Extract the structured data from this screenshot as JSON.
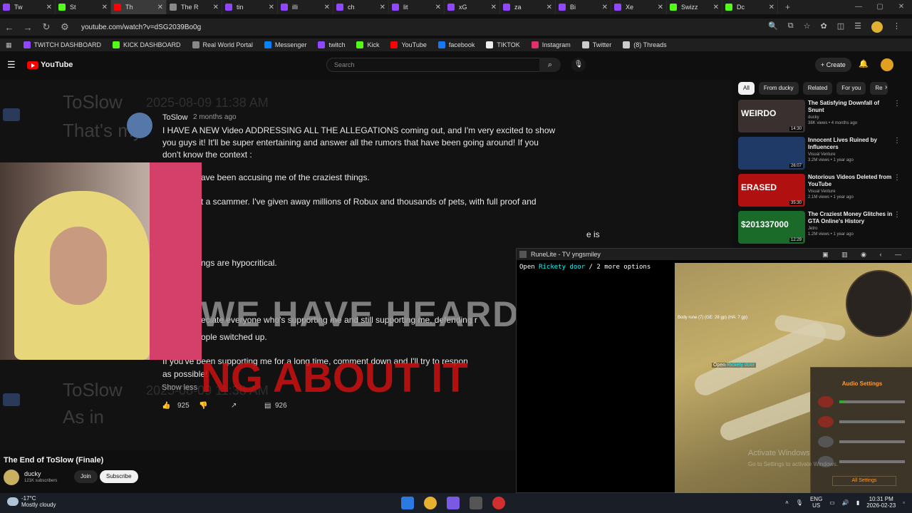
{
  "tabs": [
    {
      "label": "Tw",
      "color": "#9146ff"
    },
    {
      "label": "St",
      "color": "#53fc18"
    },
    {
      "label": "Th",
      "color": "#ff0000",
      "active": true
    },
    {
      "label": "The R",
      "color": "#888888"
    },
    {
      "label": "tin",
      "color": "#9146ff"
    },
    {
      "label": "illi",
      "color": "#9146ff"
    },
    {
      "label": "ch",
      "color": "#9146ff"
    },
    {
      "label": "lit",
      "color": "#9146ff"
    },
    {
      "label": "xG",
      "color": "#9146ff"
    },
    {
      "label": "za",
      "color": "#9146ff"
    },
    {
      "label": "Bi",
      "color": "#9146ff"
    },
    {
      "label": "Xe",
      "color": "#9146ff"
    },
    {
      "label": "Swizz",
      "color": "#53fc18"
    },
    {
      "label": "Dc",
      "color": "#53fc18"
    }
  ],
  "address": {
    "url": "youtube.com/watch?v=dSG2039Bo0g"
  },
  "bookmarks": [
    {
      "label": "TWITCH DASHBOARD",
      "color": "#9146ff"
    },
    {
      "label": "KICK DASHBOARD",
      "color": "#53fc18"
    },
    {
      "label": "Real World Portal",
      "color": "#888888"
    },
    {
      "label": "Messenger",
      "color": "#0084ff"
    },
    {
      "label": "twitch",
      "color": "#9146ff"
    },
    {
      "label": "Kick",
      "color": "#53fc18"
    },
    {
      "label": "YouTube",
      "color": "#ff0000"
    },
    {
      "label": "facebook",
      "color": "#1877f2"
    },
    {
      "label": "TIKTOK",
      "color": "#eeeeee"
    },
    {
      "label": "Instagram",
      "color": "#e1306c"
    },
    {
      "label": "Twitter",
      "color": "#cccccc"
    },
    {
      "label": "(8) Threads",
      "color": "#cccccc"
    }
  ],
  "yt": {
    "logo": "YouTube",
    "search_placeholder": "Search",
    "create": "Create"
  },
  "video": {
    "ghost_author_1": "ToSlow",
    "ghost_date_1": "2025-08-09 11:38 AM",
    "ghost_text_1": "That's my",
    "ghost_author_2": "ToSlow",
    "ghost_date_2": "2025-08-09 11:38 AM",
    "ghost_text_2": "As in",
    "comment": {
      "author": "ToSlow",
      "date": "2 months ago",
      "lines": [
        "I HAVE A NEW Video ADDRESSING ALL THE ALLEGATIONS coming out, and I'm very excited to show",
        "you guys it! It'll be super entertaining and answer all the rumors that have been going around! If you",
        "don't know the context :",
        "ave been accusing me of the craziest things.",
        "t a scammer. I've given away millions of Robux and thousands of pets, with full proof and",
        "e is",
        "ngs are hypocritical.",
        "eciate everyone who's supporting me and still supporting me, defending r",
        "ople switched up.",
        "If you've been supporting me for a long time, comment down and I'll try to respon",
        "as possible!"
      ],
      "show_less": "Show less",
      "likes": "925",
      "replies": "926"
    },
    "banner_top": "WE HAVE HEARD",
    "banner_bottom": "NG ABOUT IT"
  },
  "below": {
    "title": "The End of ToSlow (Finale)",
    "channel": "ducky",
    "subs": "121K subscribers",
    "join": "Join",
    "subscribe": "Subscribe"
  },
  "sidebar": {
    "chips": [
      "All",
      "From ducky",
      "Related",
      "For you",
      "Re"
    ],
    "items": [
      {
        "title": "The Satisfying Downfall of Snunt",
        "channel": "ducky",
        "views": "38K views • 4 months ago",
        "duration": "14:30",
        "thumb_text": "WEIRDO",
        "thumb_color": "#3a3030"
      },
      {
        "title": "Innocent Lives Ruined by Influencers",
        "channel": "Visual Venture",
        "views": "3.2M views • 1 year ago",
        "duration": "26:07",
        "thumb_text": "",
        "thumb_color": "#1f3a66"
      },
      {
        "title": "Notorious Videos Deleted from YouTube",
        "channel": "Visual Venture",
        "views": "2.1M views • 1 year ago",
        "duration": "35:30",
        "thumb_text": "ERASED",
        "thumb_color": "#b01010"
      },
      {
        "title": "The Craziest Money Glitches in GTA Online's History",
        "channel": "Jetro",
        "views": "1.2M views • 1 year ago",
        "duration": "12:29",
        "thumb_text": "$201337000",
        "thumb_color": "#1a6a2a"
      }
    ]
  },
  "runelite": {
    "title": "RuneLite - TV yngsmiley",
    "top_prefix": "Open ",
    "top_target": "Rickety door",
    "top_suffix": " / 2 more options",
    "ground_label": "Body rune (7) (GE: 28 gp) (HA: 7 gp)",
    "hover_prefix": "Open ",
    "hover_target": "Rickety door",
    "audio_title": "Audio Settings",
    "all_settings": "All Settings",
    "music_level": 0.08
  },
  "watermark": {
    "line1": "Activate Windows",
    "line2": "Go to Settings to activate Windows."
  },
  "taskbar": {
    "temp": "-17°C",
    "condition": "Mostly cloudy",
    "lang1": "ENG",
    "lang2": "US",
    "time": "10:31 PM",
    "date": "2026-02-23"
  }
}
